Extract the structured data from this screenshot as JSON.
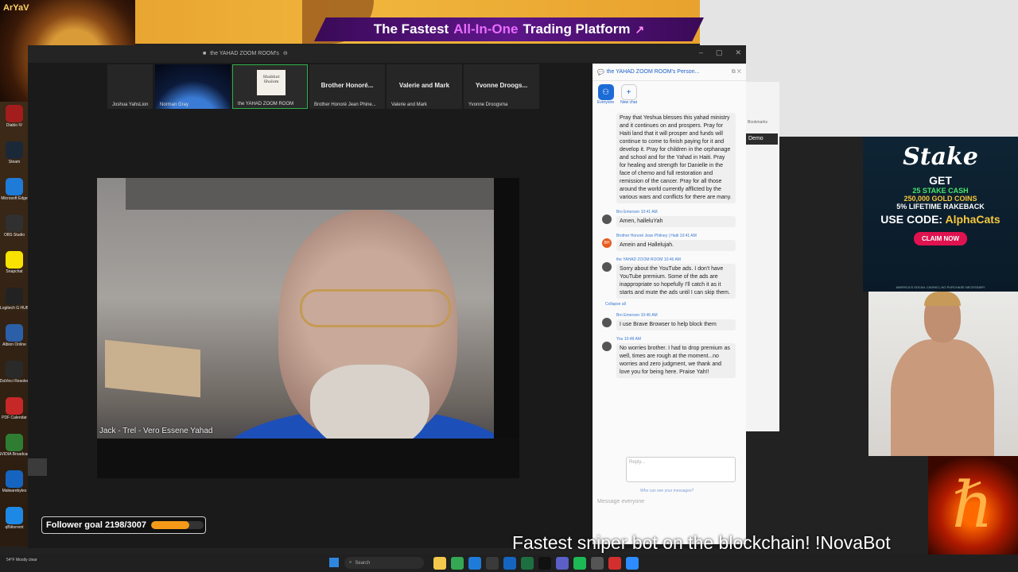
{
  "desktop": {
    "lion_text": "ArYaV",
    "icons": [
      {
        "label": "Diablo IV",
        "color": "#a31d1d"
      },
      {
        "label": "Steam",
        "color": "#1b2838"
      },
      {
        "label": "Microsoft Edge",
        "color": "#1f7bd8"
      },
      {
        "label": "OBS Studio",
        "color": "#303030"
      },
      {
        "label": "Snapchat",
        "color": "#f7e200"
      },
      {
        "label": "Logitech G HUB",
        "color": "#222222"
      },
      {
        "label": "Albion Online",
        "color": "#2b5fa8"
      },
      {
        "label": "DaVinci Resolve",
        "color": "#2a2a2a"
      },
      {
        "label": "PDF Calendar",
        "color": "#c62828"
      },
      {
        "label": "NVIDIA Broadcast",
        "color": "#2e7d32"
      },
      {
        "label": "Malwarebytes",
        "color": "#1565c0"
      },
      {
        "label": "qBittorrent",
        "color": "#1e88e5"
      }
    ]
  },
  "banner": {
    "pre": "The Fastest",
    "highlight": "All-In-One",
    "post": "Trading Platform"
  },
  "zoom": {
    "title": "the YAHAD ZOOM ROOM's",
    "window_buttons": [
      "–",
      "▢",
      "✕"
    ],
    "participants": [
      {
        "name": "Joshua YahsLion",
        "big": "",
        "style": "plain"
      },
      {
        "name": "Norman Gray",
        "big": "",
        "style": "earth"
      },
      {
        "name": "the YAHAD ZOOM ROOM",
        "big": "",
        "style": "active",
        "logo": "Shabbat Shalom"
      },
      {
        "name": "Brother Honoré Jean Phine...",
        "big": "Brother Honoré...",
        "style": "plain"
      },
      {
        "name": "Valerie and Mark",
        "big": "Valerie and Mark",
        "style": "plain"
      },
      {
        "name": "Yvonne Droogsma",
        "big": "Yvonne Droogs...",
        "style": "plain"
      }
    ],
    "speaker_name": "Jack - Trel - Vero Essene Yahad"
  },
  "chat": {
    "header": "the YAHAD ZOOM ROOM's Person...",
    "tabs": [
      {
        "label": "Everyone",
        "icon": "people-icon"
      },
      {
        "label": "New chat",
        "icon": "plus-icon"
      }
    ],
    "prayer_text": "Pray that Yeshua blesses this yahad ministry and it continues on and prospers. Pray for Haiti land that it will prosper and funds will continue to come to finish paying for it and develop it. Pray for children in the orphanage and school and for the Yahad in Haiti. Pray for healing and strength for Danielle in the face of chemo and full restoration and remission of the cancer. Pray for all those around the world currently afflicted by the various wars and conflicts for there are many.",
    "messages": [
      {
        "who": "Bro Emerson 10:41 AM",
        "text": "Amen, halleluYah",
        "avatar": ""
      },
      {
        "who": "Brother Honoré Jean Philney | Haiti 10:41 AM",
        "text": "Amein and Hallelujah.",
        "avatar": "BH"
      },
      {
        "who": "the YAHAD ZOOM ROOM 10:46 AM",
        "text": "Sorry about the YouTube ads. I don't have YouTube premium. Some of the ads are inappropriate so hopefully I'll catch it as it starts and mute the ads until I can skip them.",
        "avatar": ""
      },
      {
        "who": "Bro Emerson 10:46 AM",
        "text": "I use Brave Browser to help block them",
        "avatar": ""
      },
      {
        "who": "You 10:48 AM",
        "text": "No worries brother. I had to drop premium as well, times are rough at the moment...no worries and zero judgment, we thank and love you for being here. Praise Yah!!",
        "avatar": ""
      }
    ],
    "collapse_label": "Collapse all",
    "reply_placeholder": "Reply...",
    "who_can_see": "Who can see your messages?",
    "composer_placeholder": "Message everyone"
  },
  "bg_window": {
    "bookmarks": "Bookmarks",
    "demo": "Demo"
  },
  "stake_ad": {
    "brand": "Stake",
    "get": "GET",
    "line1": "25 STAKE CASH",
    "line2": "250,000 GOLD COINS",
    "line3": "5% LIFETIME RAKEBACK",
    "code_label": "USE CODE:",
    "code": "AlphaCats",
    "cta": "CLAIM NOW",
    "fine": "AMERICA'S SOCIAL CASINO | NO PURCHASE NECESSARY"
  },
  "follower_goal": {
    "label": "Follower goal 2198/3007",
    "current": 2198,
    "target": 3007
  },
  "ticker": "Fastest sniper bot on the blockchain! !NovaBot",
  "taskbar": {
    "weather": "54°F Mostly clear",
    "search": "Search",
    "apps": [
      {
        "name": "file-explorer-icon",
        "color": "#f2c94c"
      },
      {
        "name": "chrome-icon",
        "color": "#34a853"
      },
      {
        "name": "edge-icon",
        "color": "#1f7bd8"
      },
      {
        "name": "store-icon",
        "color": "#3a3a3a"
      },
      {
        "name": "mail-icon",
        "color": "#1565c0"
      },
      {
        "name": "excel-icon",
        "color": "#1d6f42"
      },
      {
        "name": "x-icon",
        "color": "#111111"
      },
      {
        "name": "teams-icon",
        "color": "#5b5fc7"
      },
      {
        "name": "spotify-icon",
        "color": "#1db954"
      },
      {
        "name": "settings-icon",
        "color": "#555555"
      },
      {
        "name": "opera-icon",
        "color": "#d32f2f"
      },
      {
        "name": "zoom-icon",
        "color": "#2d8cff"
      }
    ]
  }
}
